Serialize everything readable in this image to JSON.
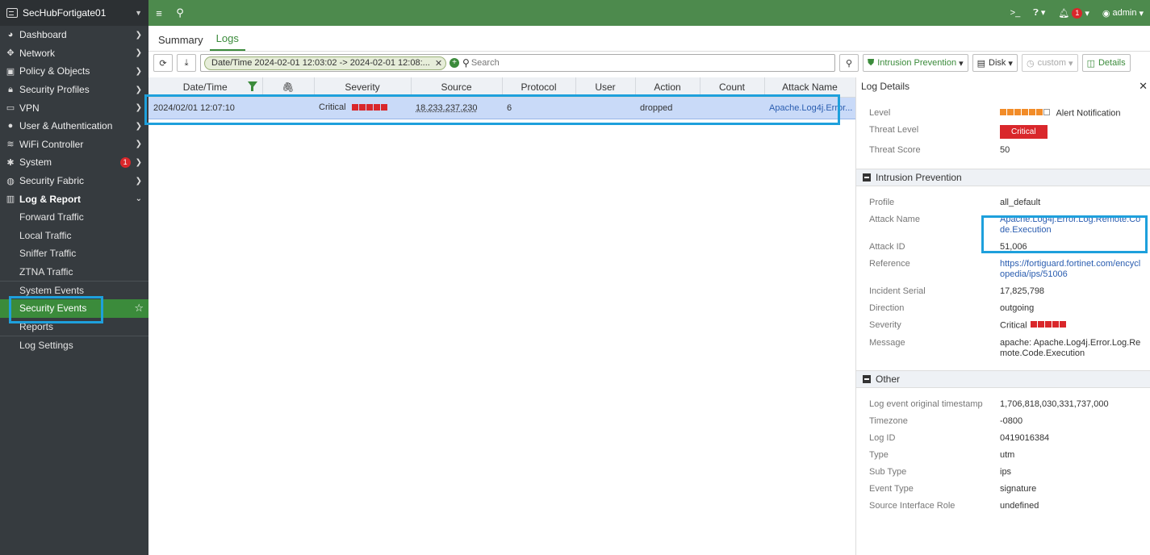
{
  "device": {
    "name": "SecHubFortigate01"
  },
  "sidebar": {
    "items": [
      {
        "label": "Dashboard",
        "icon": "dashboard-icon"
      },
      {
        "label": "Network",
        "icon": "network-icon"
      },
      {
        "label": "Policy & Objects",
        "icon": "policy-icon"
      },
      {
        "label": "Security Profiles",
        "icon": "lock-icon"
      },
      {
        "label": "VPN",
        "icon": "monitor-icon"
      },
      {
        "label": "User & Authentication",
        "icon": "user-icon"
      },
      {
        "label": "WiFi Controller",
        "icon": "wifi-icon"
      },
      {
        "label": "System",
        "icon": "gear-icon",
        "badge": "1"
      },
      {
        "label": "Security Fabric",
        "icon": "fabric-icon"
      },
      {
        "label": "Log & Report",
        "icon": "chart-icon"
      }
    ],
    "sub_items": [
      "Forward Traffic",
      "Local Traffic",
      "Sniffer Traffic",
      "ZTNA Traffic",
      "System Events",
      "Security Events",
      "Reports",
      "Log Settings"
    ]
  },
  "topbar": {
    "user": "admin",
    "notifications": "1",
    "icons": [
      "menu-icon",
      "search-icon",
      "cli-icon",
      "help-icon",
      "bell-icon",
      "user-icon"
    ]
  },
  "tabs": [
    "Summary",
    "Logs"
  ],
  "toolbar": {
    "filter_chip": "Date/Time 2024-02-01 12:03:02 -> 2024-02-01 12:08:...",
    "search_placeholder": "Search",
    "profile_button": "Intrusion Prevention",
    "disk_button": "Disk",
    "custom_button": "custom",
    "details_button": "Details"
  },
  "table": {
    "columns": [
      "Date/Time",
      "",
      "Severity",
      "Source",
      "Protocol",
      "User",
      "Action",
      "Count",
      "Attack Name"
    ],
    "rows": [
      {
        "datetime": "2024/02/01 12:07:10",
        "severity": "Critical",
        "source": "18.233.237.230",
        "protocol": "6",
        "user": "",
        "action": "dropped",
        "count": "",
        "attack_name": "Apache.Log4j.Error..."
      }
    ]
  },
  "details": {
    "title": "Log Details",
    "level_label": "Level",
    "level_value": "Alert Notification",
    "level_bars_filled": 6,
    "level_bars_total": 7,
    "threat_level_label": "Threat Level",
    "threat_level_value": "Critical",
    "threat_score_label": "Threat Score",
    "threat_score_value": "50",
    "ips_section": "Intrusion Prevention",
    "ips": [
      {
        "k": "Profile",
        "v": "all_default"
      },
      {
        "k": "Attack Name",
        "v": "Apache.Log4j.Error.Log.Remote.Code.Execution",
        "link": true
      },
      {
        "k": "Attack ID",
        "v": "51,006"
      },
      {
        "k": "Reference",
        "v": "https://fortiguard.fortinet.com/encyclopedia/ips/51006",
        "link": true
      },
      {
        "k": "Incident Serial",
        "v": "17,825,798"
      },
      {
        "k": "Direction",
        "v": "outgoing"
      },
      {
        "k": "Severity",
        "v": "Critical"
      },
      {
        "k": "Message",
        "v": "apache: Apache.Log4j.Error.Log.Remote.Code.Execution"
      }
    ],
    "other_section": "Other",
    "other": [
      {
        "k": "Log event original timestamp",
        "v": "1,706,818,030,331,737,000"
      },
      {
        "k": "Timezone",
        "v": "-0800"
      },
      {
        "k": "Log ID",
        "v": "0419016384"
      },
      {
        "k": "Type",
        "v": "utm"
      },
      {
        "k": "Sub Type",
        "v": "ips"
      },
      {
        "k": "Event Type",
        "v": "signature"
      },
      {
        "k": "Source Interface Role",
        "v": "undefined"
      }
    ]
  },
  "colors": {
    "brand_green": "#4d8a4d",
    "critical_red": "#d9272b",
    "highlight_blue": "#1ea0dc",
    "selection": "#c9daf8"
  }
}
